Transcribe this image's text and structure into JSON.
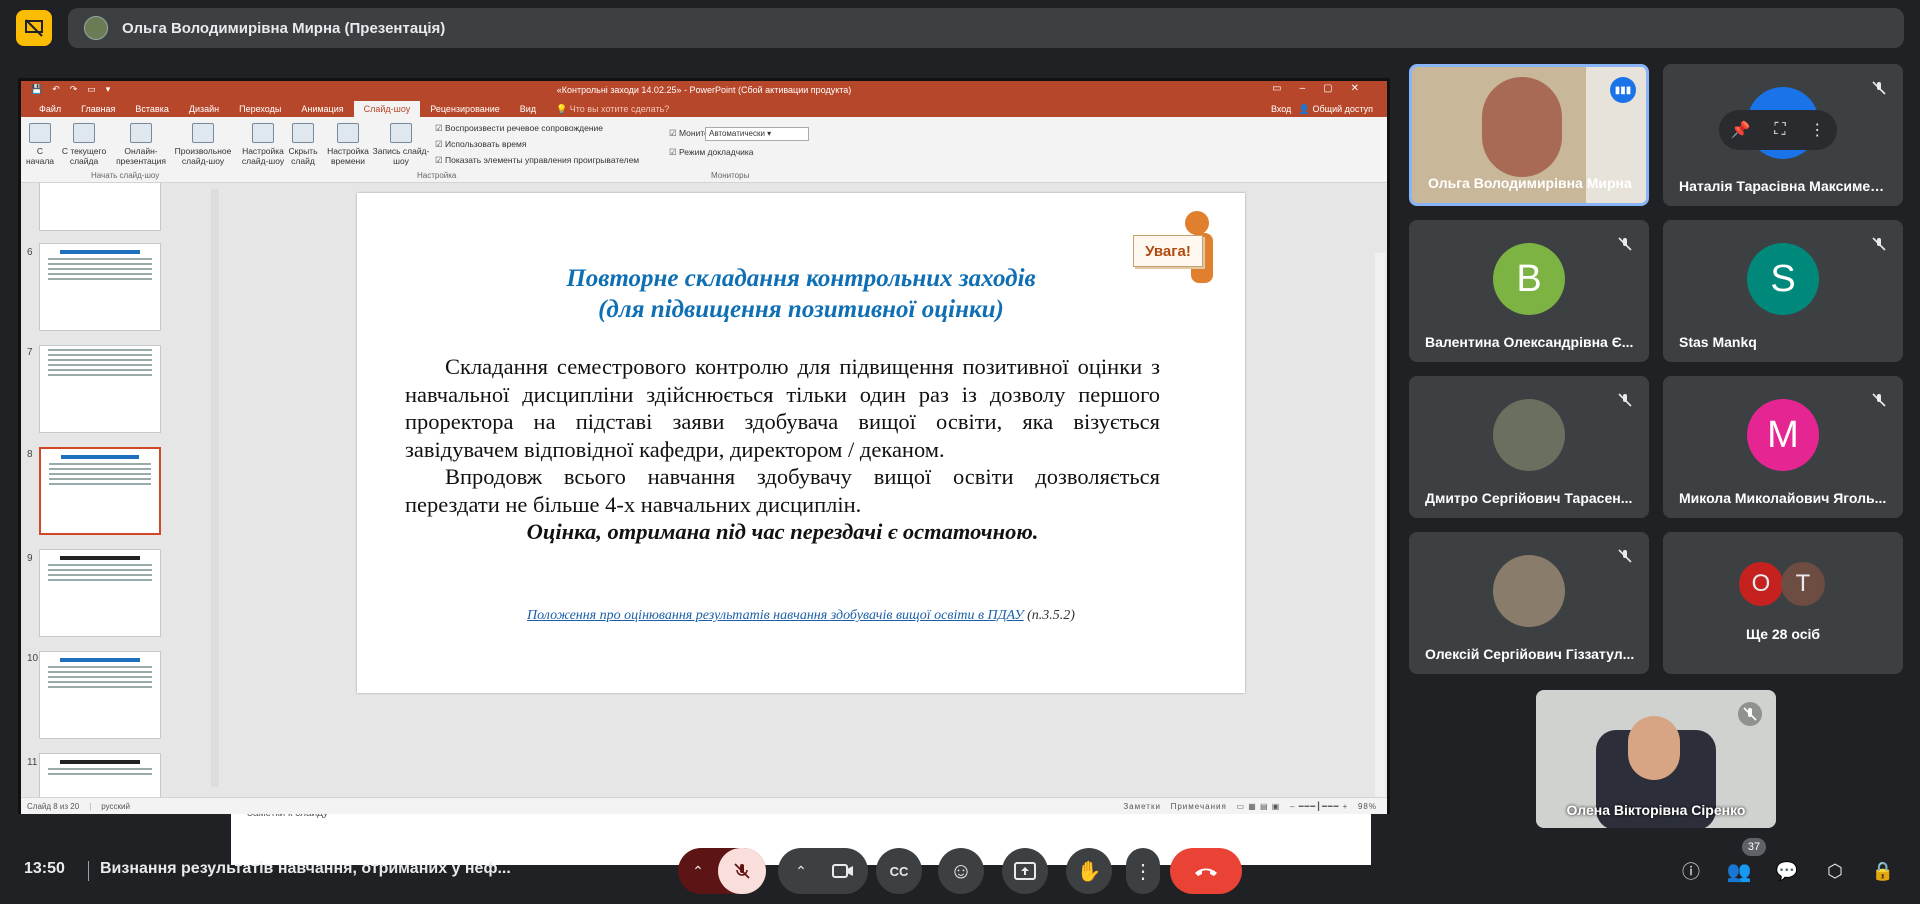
{
  "top_bar": {
    "presentation_label": "Ольга Володимирівна Мирна (Презентація)"
  },
  "ppt": {
    "window_title": "«Контрольні заходи 14.02.25» - PowerPoint (Сбой активации продукта)",
    "tabs": [
      "Файл",
      "Главная",
      "Вставка",
      "Дизайн",
      "Переходы",
      "Анимация",
      "Слайд-шоу",
      "Рецензирование",
      "Вид"
    ],
    "active_tab": "Слайд-шоу",
    "tell_me": "Что вы хотите сделать?",
    "sign_in": "Вход",
    "share": "Общий доступ",
    "ribbon": {
      "from_start": "С начала",
      "from_current": "С текущего слайда",
      "online": "Онлайн-презентация",
      "custom": "Произвольное слайд-шоу",
      "group_start": "Начать слайд-шоу",
      "setup": "Настройка слайд-шоу",
      "hide": "Скрыть слайд",
      "rehearse": "Настройка времени",
      "record": "Запись слайд-шоу",
      "chk_narration": "Воспроизвести речевое сопровождение",
      "chk_timings": "Использовать время",
      "chk_controls": "Показать элементы управления проигрывателем",
      "group_setup": "Настройка",
      "monitor_label": "Монитор:",
      "monitor_value": "Автоматически",
      "presenter_view": "Режим докладчика",
      "group_monitors": "Мониторы"
    },
    "thumb_numbers": [
      "6",
      "7",
      "8",
      "9",
      "10",
      "11"
    ],
    "slide": {
      "title_line1": "Повторне складання контрольних заходів",
      "title_line2": "(для підвищення позитивної оцінки)",
      "para1": "Складання семестрового контролю для підвищення позитивної оцінки з навчальної дисципліни здійснюється тільки один раз із дозволу першого проректора на підставі заяви здобувача вищої освіти, яка візується завідувачем відповідної кафедри, директором / деканом.",
      "para2": "Впродовж всього навчання здобувачу вищої освіти дозволяється перездати не більше 4-х навчальних дисциплін.",
      "para3": "Оцінка, отримана під час перездачі є остаточною.",
      "link_text": "Положення про оцінювання результатів навчання здобувачів вищої освіти в ПДАУ",
      "link_suffix": " (п.3.5.2)",
      "sticker": "Увага!"
    },
    "notes_placeholder": "Заметки к слайду",
    "status": {
      "slide_of": "Слайд 8 из 20",
      "language": "русский",
      "notes": "Заметки",
      "comments": "Примечания",
      "zoom": "98%"
    }
  },
  "participants": [
    {
      "name": "Ольга Володимирівна Мирна",
      "initial": "",
      "color": "",
      "speaking": true
    },
    {
      "name": "Наталія Тарасівна Максимен...",
      "initial": "",
      "color": "#1a73e8"
    },
    {
      "name": "Валентина Олександрівна Є...",
      "initial": "В",
      "color": "#7cb342"
    },
    {
      "name": "Stas Mankq",
      "initial": "S",
      "color": "#00897b"
    },
    {
      "name": "Дмитро Сергійович Тарасен...",
      "initial": "",
      "color": ""
    },
    {
      "name": "Микола Миколайович Яголь...",
      "initial": "M",
      "color": "#e52592"
    },
    {
      "name": "Олексій Сергійович Гіззатул...",
      "initial": "",
      "color": ""
    },
    {
      "name": "Ще 28 осіб",
      "initials": [
        "O",
        "T"
      ],
      "colors": [
        "#c5221f",
        "#6d4c41"
      ]
    }
  ],
  "self_view": {
    "name": "Олена Вікторівна Сіренко"
  },
  "bottom": {
    "time": "13:50",
    "meeting_title": "Визнання результатів навчання, отриманих у неф...",
    "participant_count": "37"
  },
  "colors": {
    "accent": "#8ab4f8",
    "end_call": "#ea4335",
    "mic_off_bg": "#f9dedc"
  }
}
